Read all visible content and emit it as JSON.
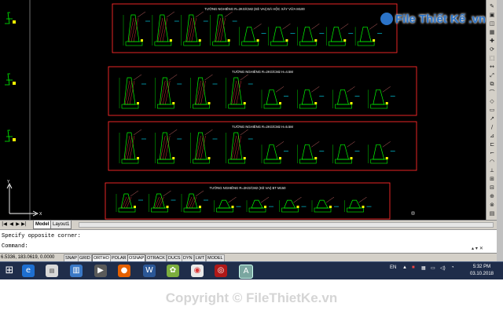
{
  "drawing": {
    "panels": [
      {
        "title": "TƯỜNG NGHIÊNG R=2KG/CM2 (KÈ VAI) ĐÁ HỘC XÂY VỮA M100"
      },
      {
        "title": "TƯỜNG NGHIÊNG R=2KG/CM2 H=4.5M"
      },
      {
        "title": "TƯỜNG NGHIÊNG R=2KG/CM2 H=5.5M"
      },
      {
        "title": "TƯỜNG NGHIÊNG R=2KG/CM2 (KÈ VAI) BT M150"
      }
    ],
    "ucs_x": "X",
    "ucs_y": "Y",
    "colors": {
      "background": "#000000",
      "frame": "#ff2a2a",
      "geometry": "#00ff00",
      "accent": "#ffff00",
      "hatch": "#ff4040"
    }
  },
  "tabs": {
    "model": "Model",
    "layout1": "Layout1"
  },
  "nav_icons": [
    "first-tab-icon",
    "prev-tab-icon",
    "next-tab-icon",
    "last-tab-icon"
  ],
  "command": {
    "history": "Specify opposite corner:",
    "prompt": "Command:"
  },
  "status": {
    "coordinates": "6.5336, 183.0619, 0.0000",
    "toggles": [
      "SNAP",
      "GRID",
      "ORTHO",
      "POLAR",
      "OSNAP",
      "OTRACK",
      "DUCS",
      "DYN",
      "LWT",
      "MODEL"
    ]
  },
  "taskbar": {
    "apps": [
      "start",
      "edge",
      "file-manager",
      "library",
      "media",
      "firefox",
      "word",
      "picasa",
      "chrome",
      "autocad",
      "apps"
    ],
    "lang": "EN",
    "time": "5:32 PM",
    "date": "03.10.2018"
  },
  "watermark": {
    "top": "File Thiết Kế .vn",
    "bottom": "Copyright © FileThietKe.vn"
  }
}
